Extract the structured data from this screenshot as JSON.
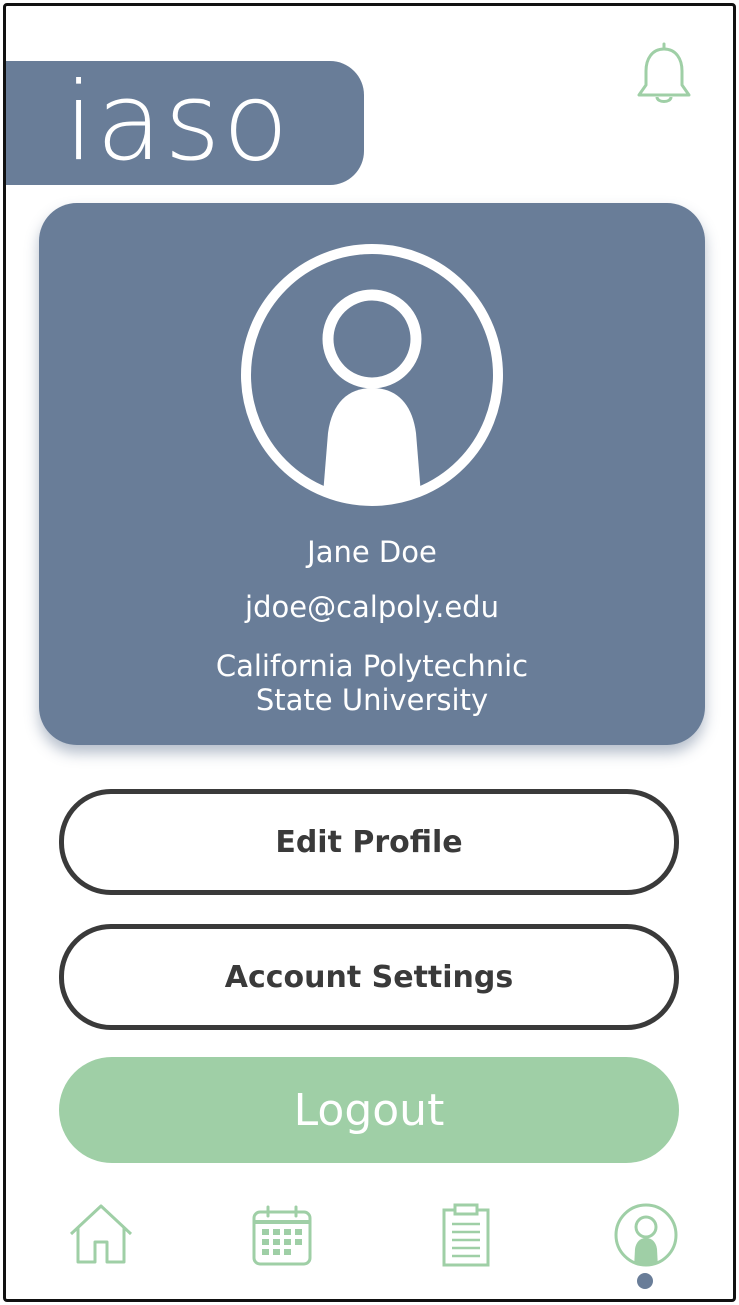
{
  "app": {
    "logo": "iaso"
  },
  "header": {
    "notification_icon": "bell-icon"
  },
  "profile": {
    "avatar_icon": "user-avatar-icon",
    "name": "Jane Doe",
    "email": "jdoe@calpoly.edu",
    "school_line1": "California Polytechnic",
    "school_line2": "State University"
  },
  "actions": {
    "edit_profile": "Edit Profile",
    "account_settings": "Account Settings",
    "logout": "Logout"
  },
  "bottom_nav": {
    "items": [
      {
        "icon": "home-icon",
        "active": false
      },
      {
        "icon": "calendar-icon",
        "active": false
      },
      {
        "icon": "clipboard-icon",
        "active": false
      },
      {
        "icon": "profile-icon",
        "active": true
      }
    ]
  },
  "colors": {
    "primary": "#697d98",
    "accent_green": "#9fcfa6",
    "outline": "#3a3a3a",
    "background": "#ffffff"
  }
}
